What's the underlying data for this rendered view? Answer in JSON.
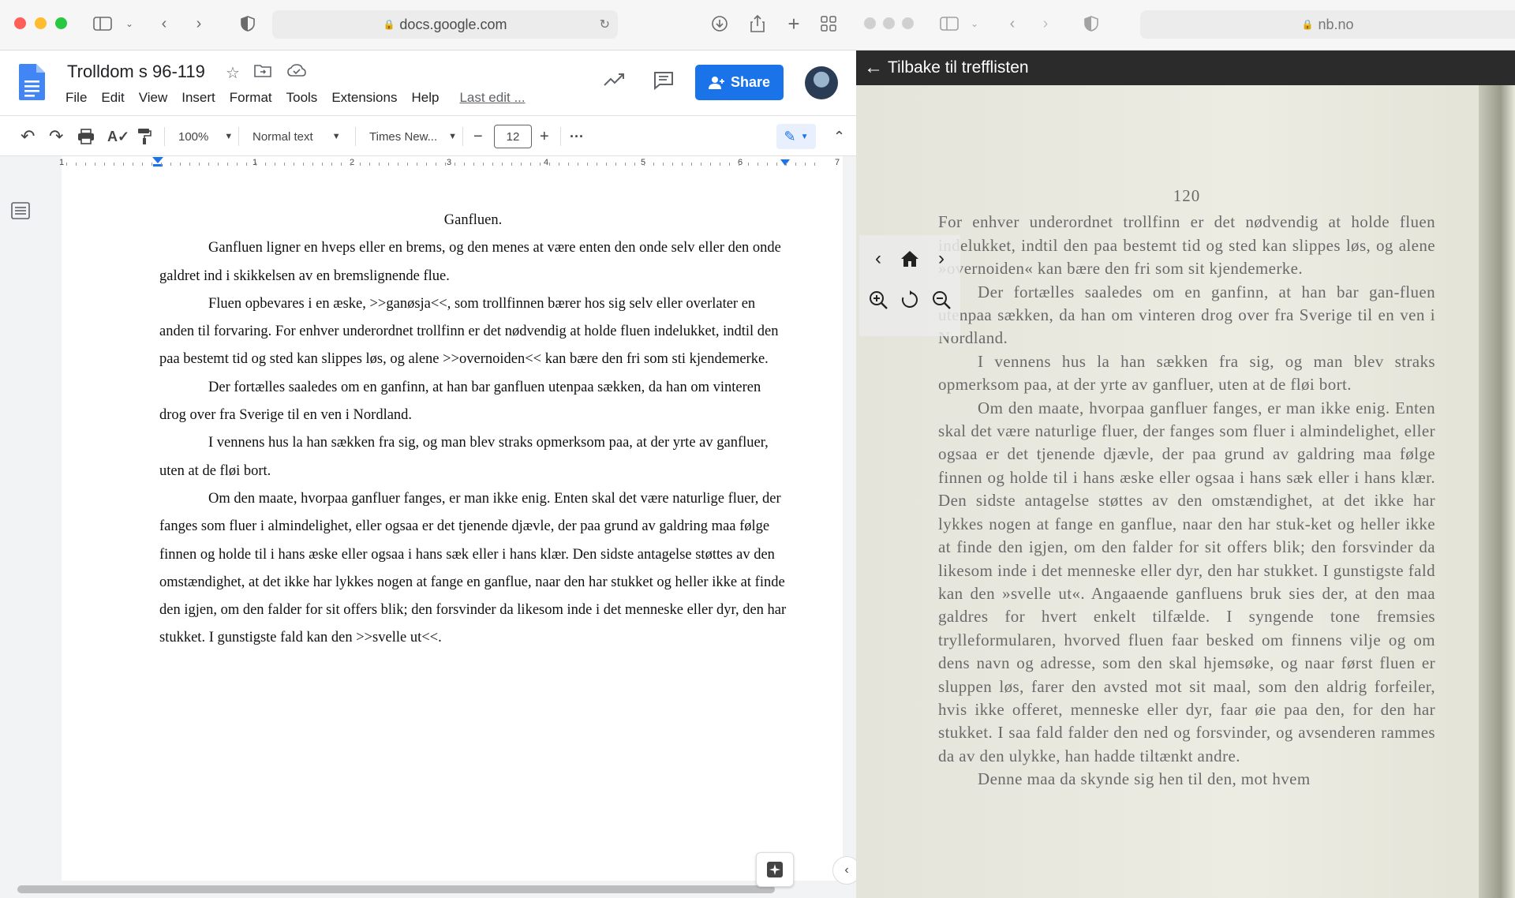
{
  "left_window": {
    "url": "docs.google.com",
    "doc_title": "Trolldom s 96-119",
    "menu": [
      "File",
      "Edit",
      "View",
      "Insert",
      "Format",
      "Tools",
      "Extensions",
      "Help"
    ],
    "last_edit": "Last edit ...",
    "share_label": "Share",
    "toolbar": {
      "zoom": "100%",
      "style": "Normal text",
      "font": "Times New...",
      "font_size": "12",
      "minus": "−",
      "plus": "+",
      "more": "···"
    },
    "ruler_numbers": [
      "1",
      "1",
      "2",
      "3",
      "4",
      "5",
      "6",
      "7"
    ],
    "document": {
      "heading": "Ganfluen.",
      "paragraphs": [
        "Ganfluen ligner en hveps eller en brems, og den menes at være enten den onde selv eller den onde galdret ind i skikkelsen av en bremslignende flue.",
        "Fluen opbevares i en æske, >>ganøsja<<, som trollfinnen bærer hos sig selv eller overlater en anden til forvaring. For enhver underordnet trollfinn er det nødvendig at holde fluen indelukket, indtil den paa bestemt tid og sted kan slippes løs, og alene >>overnoiden<< kan bære den fri som sti kjendemerke.",
        "Der fortælles saaledes om en ganfinn, at han bar ganfluen utenpaa sækken, da han om vinteren drog over fra Sverige til en ven i Nordland.",
        "I vennens hus la han sækken fra sig, og man blev straks opmerksom paa, at der yrte av ganfluer, uten at de fløi bort.",
        "Om den maate, hvorpaa ganfluer fanges, er man ikke enig. Enten skal det være naturlige fluer, der fanges som fluer i almindelighet, eller ogsaa er det tjenende djævle, der paa grund av galdring maa følge finnen og holde til i hans æske eller ogsaa i hans sæk eller i hans klær. Den sidste antagelse støttes av den omstændighet, at det ikke har lykkes nogen at fange en ganflue, naar den har stukket og heller ikke at finde den igjen, om den falder for sit offers blik; den forsvinder da likesom inde i det menneske eller dyr, den har stukket. I gunstigste fald kan den >>svelle ut<<."
      ]
    }
  },
  "right_window": {
    "url": "nb.no",
    "back_label": "Tilbake til trefflisten",
    "scan": {
      "page_number": "120",
      "paragraphs": [
        {
          "indent": false,
          "text": "For enhver underordnet trollfinn er det nødvendig at holde fluen indelukket, indtil den paa bestemt tid og sted kan slippes løs, og alene »overnoiden« kan bære den fri som sit kjendemerke."
        },
        {
          "indent": true,
          "text": "Der fortælles saaledes om en ganfinn, at han bar gan-fluen utenpaa sækken, da han om vinteren drog over fra Sverige til en ven i Nordland."
        },
        {
          "indent": true,
          "text": "I vennens hus la han sækken fra sig, og man blev straks opmerksom paa, at der yrte av ganfluer, uten at de fløi bort."
        },
        {
          "indent": true,
          "text": "Om den maate, hvorpaa ganfluer fanges, er man ikke enig. Enten skal det være naturlige fluer, der fanges som fluer i almindelighet, eller ogsaa er det tjenende djævle, der paa grund av galdring maa følge finnen og holde til i hans æske eller ogsaa i hans sæk eller i hans klær. Den sidste antagelse støttes av den omstændighet, at det ikke har lykkes nogen at fange en ganflue, naar den har stuk-ket og heller ikke at finde den igjen, om den falder for sit offers blik; den forsvinder da likesom inde i det menneske eller dyr, den har stukket. I gunstigste fald kan den »svelle ut«. Angaaende ganfluens bruk sies der, at den maa galdres for hvert enkelt tilfælde. I syngende tone fremsies trylleformularen, hvorved fluen faar besked om finnens vilje og om dens navn og adresse, som den skal hjemsøke, og naar først fluen er sluppen løs, farer den avsted mot sit maal, som den aldrig forfeiler, hvis ikke offeret, menneske eller dyr, faar øie paa den, for den har stukket. I saa fald falder den ned og forsvinder, og avsenderen rammes da av den ulykke, han hadde tiltænkt andre."
        },
        {
          "indent": true,
          "text": "Denne maa da skynde sig hen til den, mot hvem"
        }
      ]
    }
  },
  "colors": {
    "share_blue": "#1a73e8",
    "close_red": "#ff5f57",
    "min_yellow": "#febc2e",
    "max_green": "#28c840"
  }
}
